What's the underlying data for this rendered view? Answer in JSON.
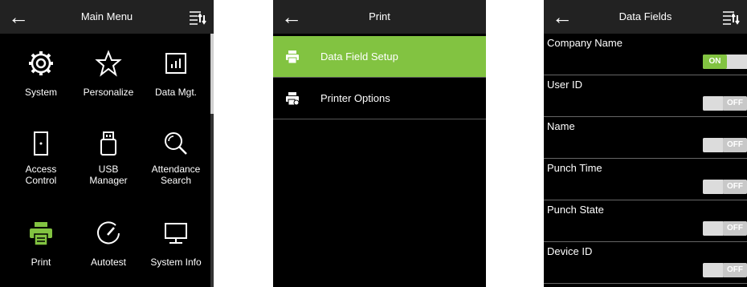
{
  "main_menu": {
    "title": "Main Menu",
    "items": [
      {
        "label": "System",
        "icon": "gear-icon"
      },
      {
        "label": "Personalize",
        "icon": "star-icon"
      },
      {
        "label": "Data Mgt.",
        "icon": "bar-chart-icon"
      },
      {
        "label": "Access\nControl",
        "icon": "door-icon"
      },
      {
        "label": "USB\nManager",
        "icon": "usb-icon"
      },
      {
        "label": "Attendance\nSearch",
        "icon": "search-icon"
      },
      {
        "label": "Print",
        "icon": "printer-icon"
      },
      {
        "label": "Autotest",
        "icon": "gauge-icon"
      },
      {
        "label": "System Info",
        "icon": "monitor-icon"
      }
    ]
  },
  "print_menu": {
    "title": "Print",
    "items": [
      {
        "label": "Data Field Setup",
        "icon": "printer-icon",
        "selected": true
      },
      {
        "label": "Printer Options",
        "icon": "printer-settings-icon",
        "selected": false
      }
    ]
  },
  "data_fields": {
    "title": "Data Fields",
    "items": [
      {
        "label": "Company Name",
        "state": "ON"
      },
      {
        "label": "User ID",
        "state": "OFF"
      },
      {
        "label": "Name",
        "state": "OFF"
      },
      {
        "label": "Punch Time",
        "state": "OFF"
      },
      {
        "label": "Punch State",
        "state": "OFF"
      },
      {
        "label": "Device ID",
        "state": "OFF"
      }
    ]
  },
  "colors": {
    "accent": "#82c341",
    "header": "#222222",
    "background": "#000000"
  }
}
